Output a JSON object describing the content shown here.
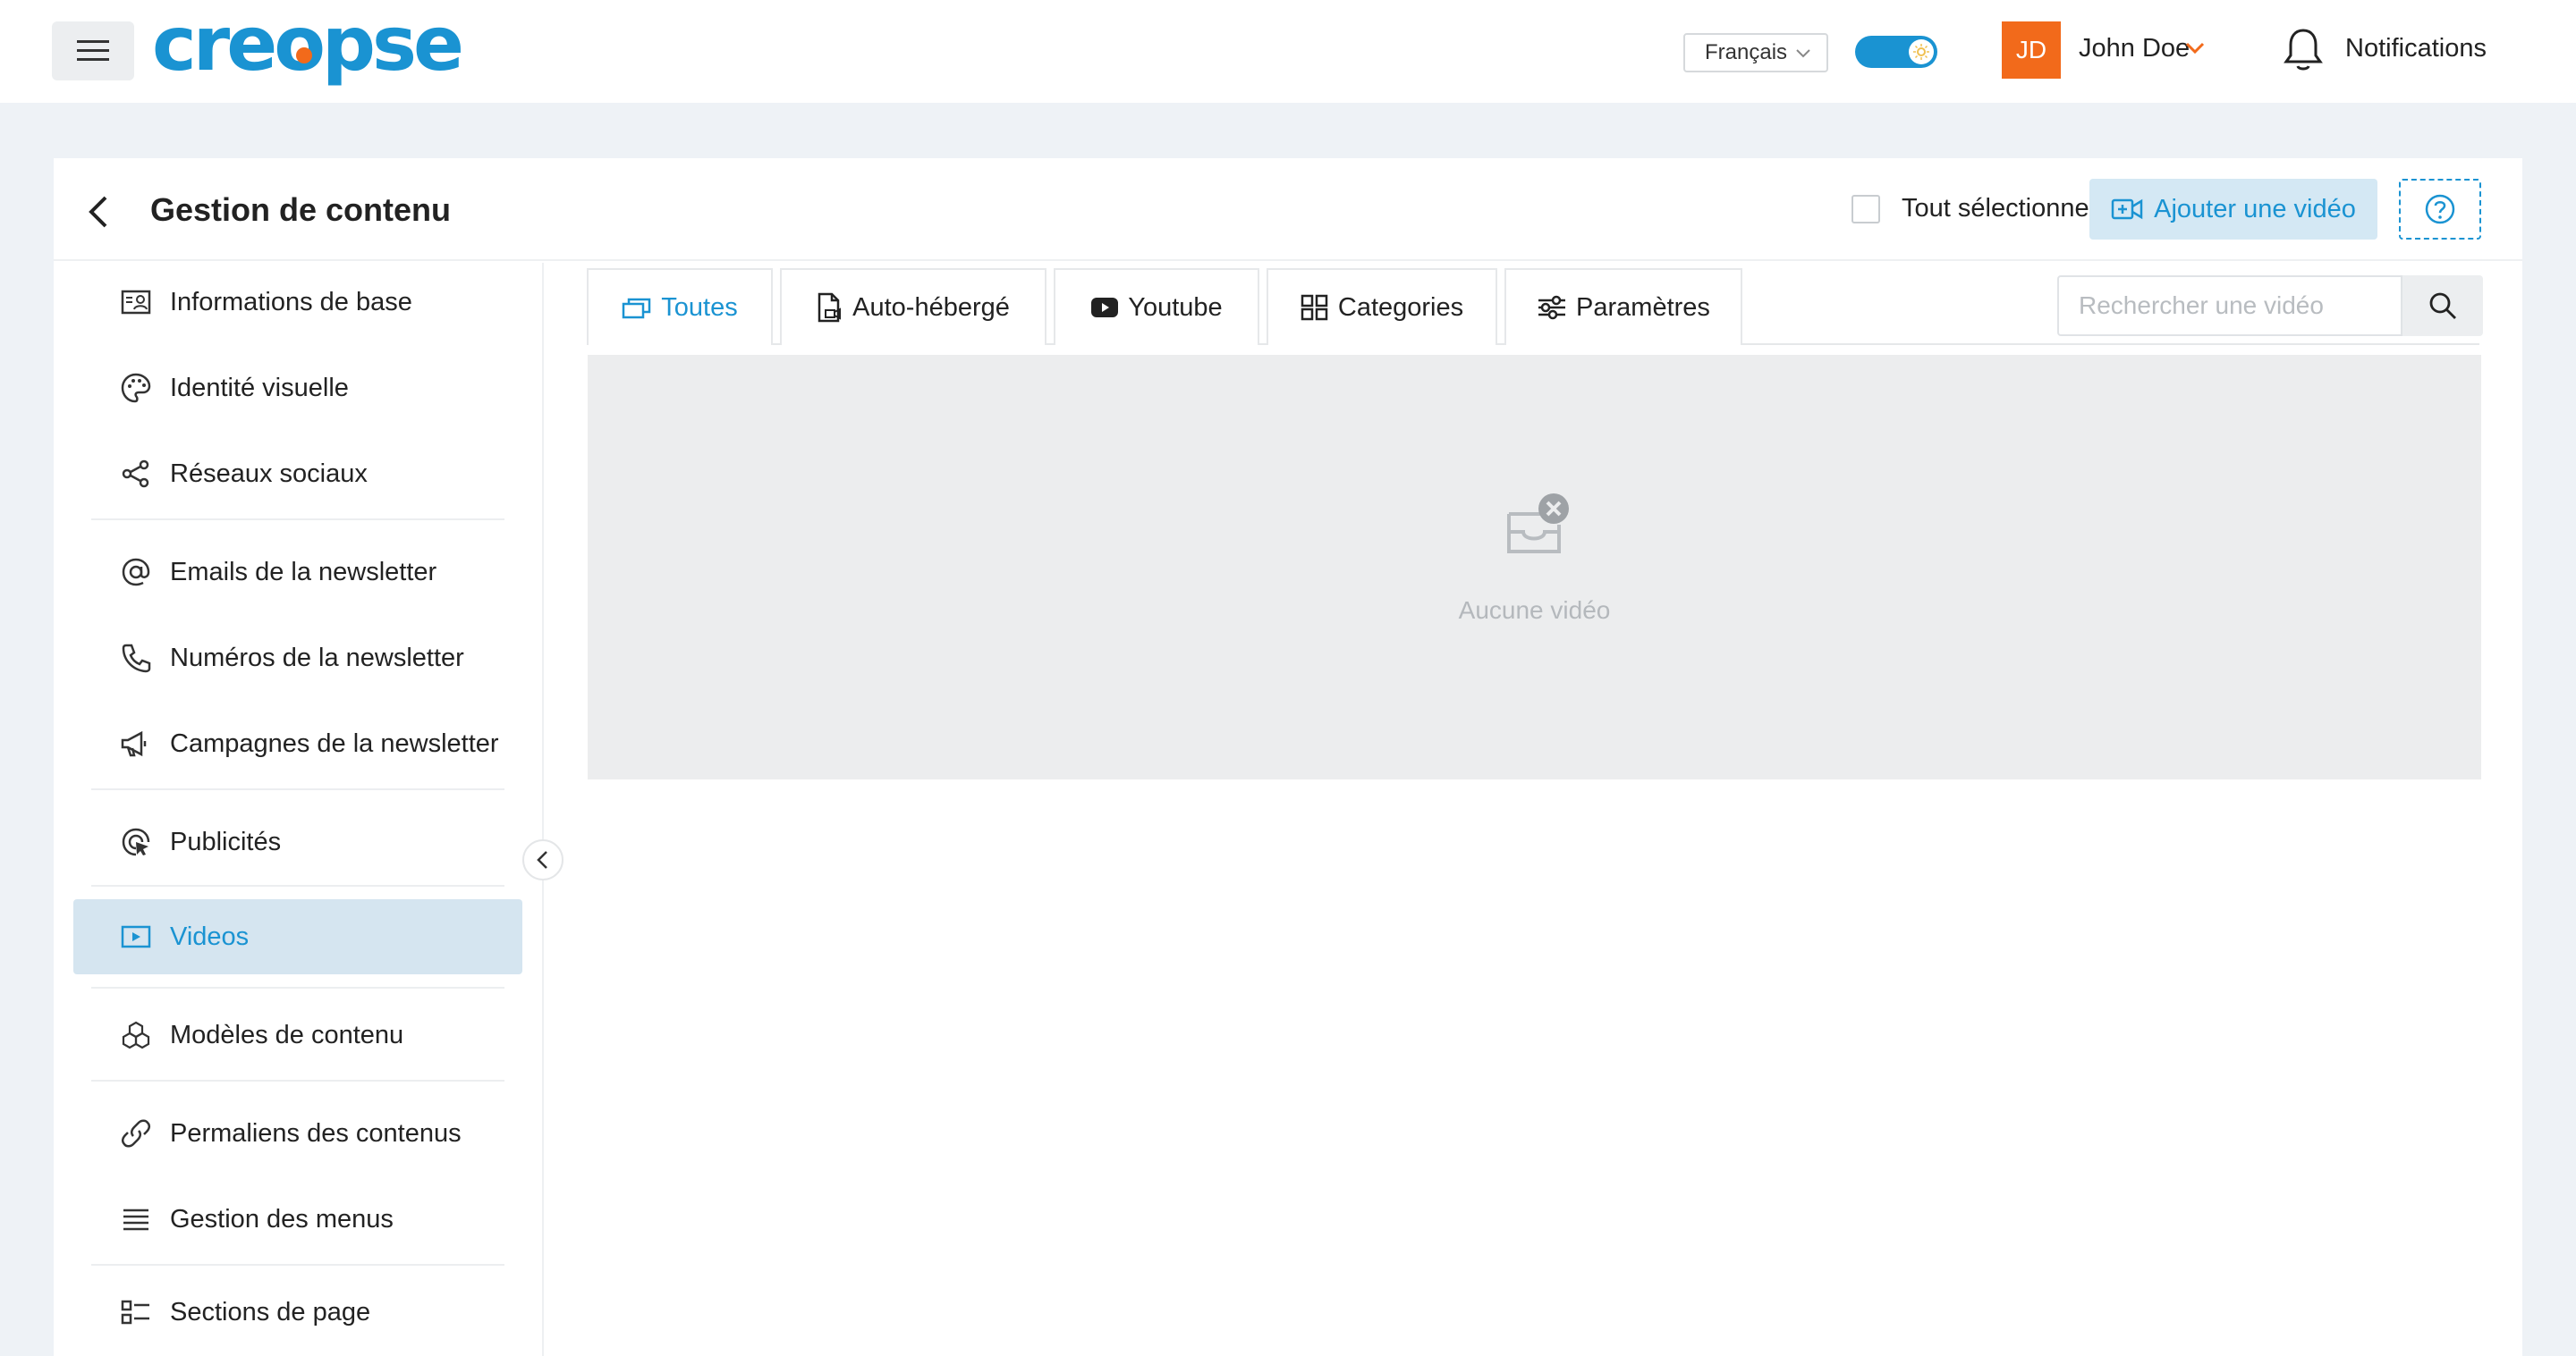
{
  "app": {
    "brand": "creopse",
    "brand_color": "#1a93d2",
    "accent_color": "#f26a1b"
  },
  "topbar": {
    "menu_icon": "hamburger-icon",
    "language": "Français",
    "theme_toggle_on": true,
    "user": {
      "initials": "JD",
      "name": "John Doe"
    },
    "notifications_label": "Notifications"
  },
  "header": {
    "title": "Gestion de contenu",
    "select_all_label": "Tout sélectionner",
    "add_video_label": "Ajouter une vidéo",
    "help_icon": "question-circle-icon"
  },
  "sidebar": {
    "items": [
      {
        "label": "Informations de base",
        "icon": "id-card-icon"
      },
      {
        "label": "Identité visuelle",
        "icon": "palette-icon"
      },
      {
        "label": "Réseaux sociaux",
        "icon": "share-icon"
      },
      {
        "label": "Emails de la newsletter",
        "icon": "at-icon"
      },
      {
        "label": "Numéros de la newsletter",
        "icon": "phone-icon"
      },
      {
        "label": "Campagnes de la newsletter",
        "icon": "megaphone-icon"
      },
      {
        "label": "Publicités",
        "icon": "target-click-icon"
      },
      {
        "label": "Videos",
        "icon": "video-play-icon",
        "active": true
      },
      {
        "label": "Modèles de contenu",
        "icon": "cubes-icon"
      },
      {
        "label": "Permaliens des contenus",
        "icon": "link-icon"
      },
      {
        "label": "Gestion des menus",
        "icon": "list-icon"
      },
      {
        "label": "Sections de page",
        "icon": "sections-icon"
      }
    ]
  },
  "tabs": [
    {
      "label": "Toutes",
      "icon": "windows-icon",
      "active": true
    },
    {
      "label": "Auto-hébergé",
      "icon": "file-video-icon"
    },
    {
      "label": "Youtube",
      "icon": "youtube-icon"
    },
    {
      "label": "Categories",
      "icon": "grid-icon"
    },
    {
      "label": "Paramètres",
      "icon": "sliders-icon"
    }
  ],
  "search": {
    "placeholder": "Rechercher une vidéo"
  },
  "empty_state": {
    "text": "Aucune vidéo",
    "icon": "empty-inbox-icon"
  }
}
